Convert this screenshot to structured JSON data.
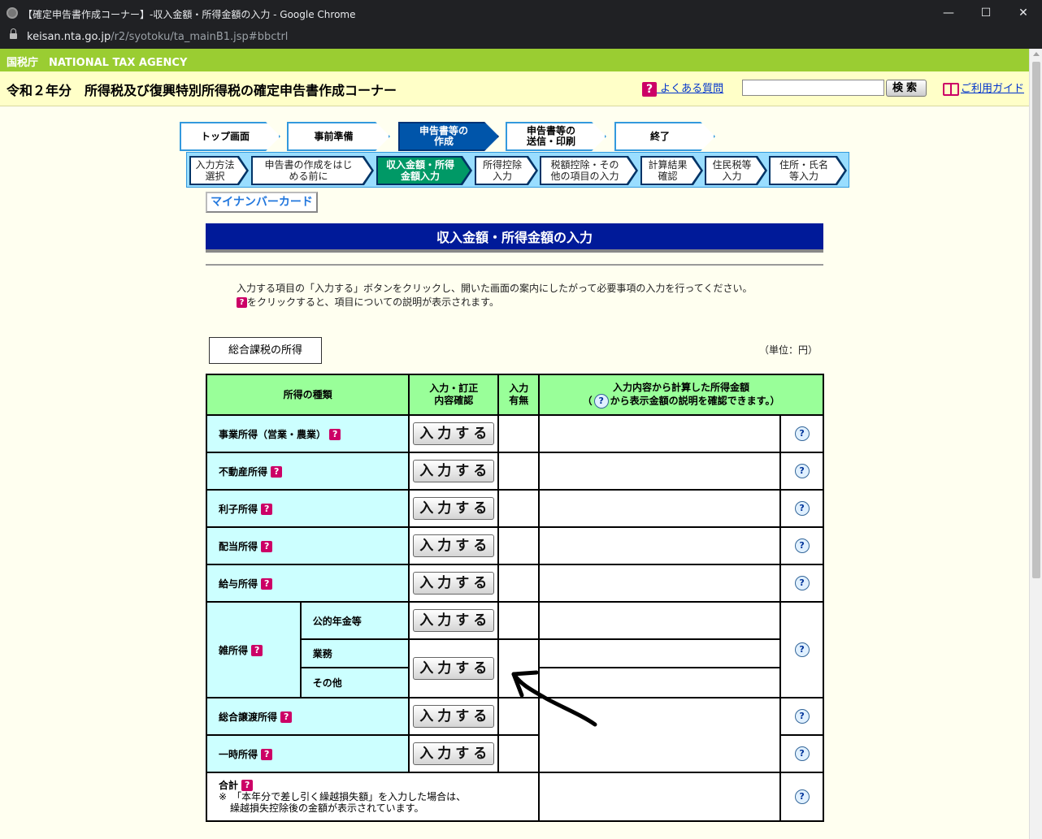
{
  "browser": {
    "title": "【確定申告書作成コーナー】-収入金額・所得金額の入力 - Google Chrome",
    "url_host": "keisan.nta.go.jp",
    "url_path": "/r2/syotoku/ta_mainB1.jsp#bbctrl",
    "min": "—",
    "max": "☐",
    "close": "✕"
  },
  "site": {
    "agency": "国税庁　NATIONAL TAX AGENCY",
    "page_title": "令和２年分　所得税及び復興特別所得税の確定申告書作成コーナー",
    "faq": "よくある質問",
    "search_button": "検索",
    "guide": "ご利用ガイド"
  },
  "steps_main": [
    {
      "label": "トップ画面"
    },
    {
      "label": "事前準備"
    },
    {
      "label": "申告書等の\n作成"
    },
    {
      "label": "申告書等の\n送信・印刷"
    },
    {
      "label": "終了"
    }
  ],
  "steps_sub": [
    {
      "label": "入力方法\n選択"
    },
    {
      "label": "申告書の作成をはじ\nめる前に"
    },
    {
      "label": "収入金額・所得\n金額入力"
    },
    {
      "label": "所得控除\n入力"
    },
    {
      "label": "税額控除・その\n他の項目の入力"
    },
    {
      "label": "計算結果\n確認"
    },
    {
      "label": "住民税等\n入力"
    },
    {
      "label": "住所・氏名\n等入力"
    }
  ],
  "mynumber": "マイナンバーカード",
  "section_title": "収入金額・所得金額の入力",
  "instructions": {
    "line1": "入力する項目の「入力する」ボタンをクリックし、開いた画面の案内にしたがって必要事項の入力を行ってください。",
    "line2": "をクリックすると、項目についての説明が表示されます。"
  },
  "tab_label": "総合課税の所得",
  "unit": "（単位：円）",
  "table": {
    "headers": {
      "kind": "所得の種類",
      "input": "入力・訂正\n内容確認",
      "status": "入力\n有無",
      "amount_line1": "入力内容から計算した所得金額",
      "amount_line2": "から表示金額の説明を確認できます。）",
      "amount_prefix": "（"
    },
    "rows": [
      {
        "kind": "事業所得（営業・農業）"
      },
      {
        "kind": "不動産所得"
      },
      {
        "kind": "利子所得"
      },
      {
        "kind": "配当所得"
      },
      {
        "kind": "給与所得"
      }
    ],
    "misc": {
      "kind": "雑所得",
      "sub1": "公的年金等",
      "sub2": "業務",
      "sub3": "その他"
    },
    "rows2": [
      {
        "kind": "総合譲渡所得"
      },
      {
        "kind": "一時所得"
      }
    ],
    "total": {
      "label": "合計",
      "note_mark": "※",
      "note_line1": "「本年分で差し引く繰越損失額」を入力した場合は、",
      "note_line2": "繰越損失控除後の金額が表示されています。"
    },
    "input_button": "入力する",
    "help_q": "?"
  },
  "icons": {
    "faq_icon": "question-red-icon",
    "guide_icon": "book-icon",
    "help_icon": "help-bubble-icon"
  },
  "colors": {
    "agency_bar": "#9acd32",
    "header_bg": "#ffffc8",
    "section_title_bg": "#001a99",
    "table_header_bg": "#99ff99",
    "kind_cell_bg": "#ccffff",
    "active_sub_step": "#009966",
    "active_main_step": "#0055aa"
  }
}
